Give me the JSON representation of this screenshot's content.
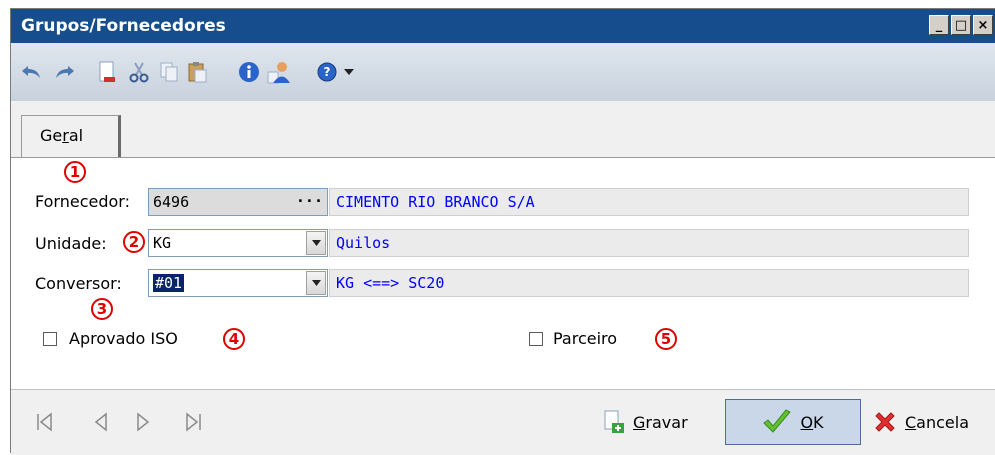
{
  "window": {
    "title": "Grupos/Fornecedores",
    "buttons": [
      "_",
      "□",
      "×"
    ]
  },
  "toolbar": {
    "icons": [
      "undo-icon",
      "redo-icon",
      "new-document-icon",
      "cut-icon",
      "copy-icon",
      "paste-icon",
      "info-icon",
      "user-icon",
      "help-icon",
      "dropdown-arrow-icon"
    ]
  },
  "tabs": [
    {
      "label_pre": "Ge",
      "label_underlined": "r",
      "label_post": "al"
    }
  ],
  "form": {
    "fornecedor": {
      "label": "Fornecedor:",
      "value": "6496",
      "button": "···",
      "description": "CIMENTO RIO BRANCO S/A"
    },
    "unidade": {
      "label": "Unidade:",
      "value": "KG",
      "description": "Quilos"
    },
    "conversor": {
      "label": "Conversor:",
      "value": "#01",
      "description": "KG <==> SC20"
    },
    "aprovado_iso": {
      "label": "Aprovado ISO",
      "checked": false
    },
    "parceiro": {
      "label": "Parceiro",
      "checked": false
    }
  },
  "annotations": [
    "1",
    "2",
    "3",
    "4",
    "5"
  ],
  "bottom": {
    "nav_icons": [
      "first-record-icon",
      "previous-record-icon",
      "next-record-icon",
      "last-record-icon"
    ],
    "gravar": {
      "underlined": "G",
      "rest": "ravar"
    },
    "ok": {
      "underlined": "O",
      "rest": "K"
    },
    "cancela": {
      "underlined": "C",
      "rest": "ancela"
    }
  },
  "colors": {
    "titlebar": "#164d8c",
    "description_text": "#0000ff",
    "annotation": "#e00000"
  }
}
